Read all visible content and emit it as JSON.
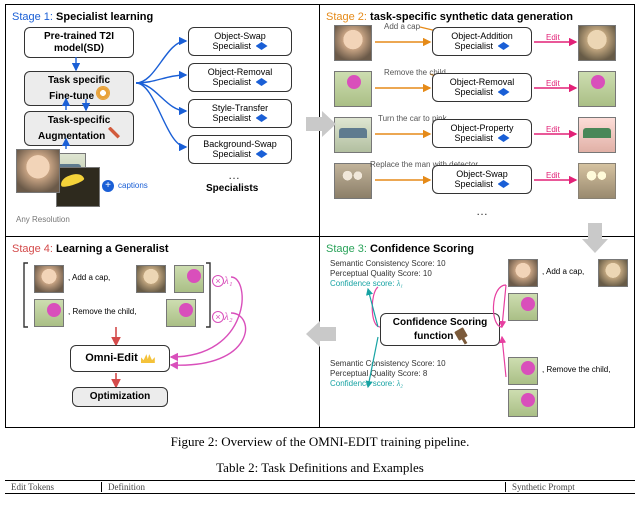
{
  "stages": {
    "s1": {
      "label_prefix": "Stage 1: ",
      "label": "Specialist learning"
    },
    "s2": {
      "label_prefix": "Stage 2: ",
      "label": "task-specific synthetic data generation"
    },
    "s3": {
      "label_prefix": "Stage 3: ",
      "label": "Confidence Scoring"
    },
    "s4": {
      "label_prefix": "Stage 4: ",
      "label": "Learning a Generalist"
    }
  },
  "s1_nodes": {
    "pretrained": "Pre-trained T2I\nmodel(SD)",
    "finetune": "Task specific\nFine-tune",
    "augment": "Task-specific\nAugmentation",
    "specialists": [
      "Object-Swap\nSpecialist",
      "Object-Removal\nSpecialist",
      "Style-Transfer\nSpecialist",
      "Background-Swap\nSpecialist"
    ],
    "specialists_label": "Specialists",
    "captions_label": "captions",
    "any_res": "Any Resolution"
  },
  "s2_rows": [
    {
      "prompt": "Add a cap",
      "box": "Object-Addition\nSpecialist",
      "edit": "Edit"
    },
    {
      "prompt": "Remove the child",
      "box": "Object-Removal\nSpecialist",
      "edit": "Edit"
    },
    {
      "prompt": "Turn the car to pink",
      "box": "Object-Property\nSpecialist",
      "edit": "Edit"
    },
    {
      "prompt": "Replace the man with detector",
      "box": "Object-Swap\nSpecialist",
      "edit": "Edit"
    }
  ],
  "s3": {
    "top": {
      "sc": "Semantic Consistency Score:  10",
      "pq": "Perceptual Quality Score:  10",
      "conf_label": "Confidence score:",
      "conf_val": "λ₁"
    },
    "box": "Confidence Scoring\nfunction",
    "bottom": {
      "sc": "Semantic Consistency Score:  10",
      "pq": "Perceptual Quality Score:  8",
      "conf_label": "Confidence score:",
      "conf_val": "λ₂"
    },
    "pair1_caption": ", Add a cap,",
    "pair2_caption": ", Remove the child,"
  },
  "s4": {
    "omni": "Omni-Edit",
    "opt": "Optimization",
    "cap1": ", Add a cap,",
    "cap2": ", Remove the child,",
    "l1": "λ₁",
    "l2": "λ₂"
  },
  "figure_caption": "Figure 2: Overview of the OMNI-EDIT training pipeline.",
  "table_caption": "Table 2: Task Definitions and Examples",
  "table_head": {
    "c1": "Edit Tokens",
    "c2": "Definition",
    "c3": "Synthetic Prompt"
  },
  "ellipsis": "…"
}
